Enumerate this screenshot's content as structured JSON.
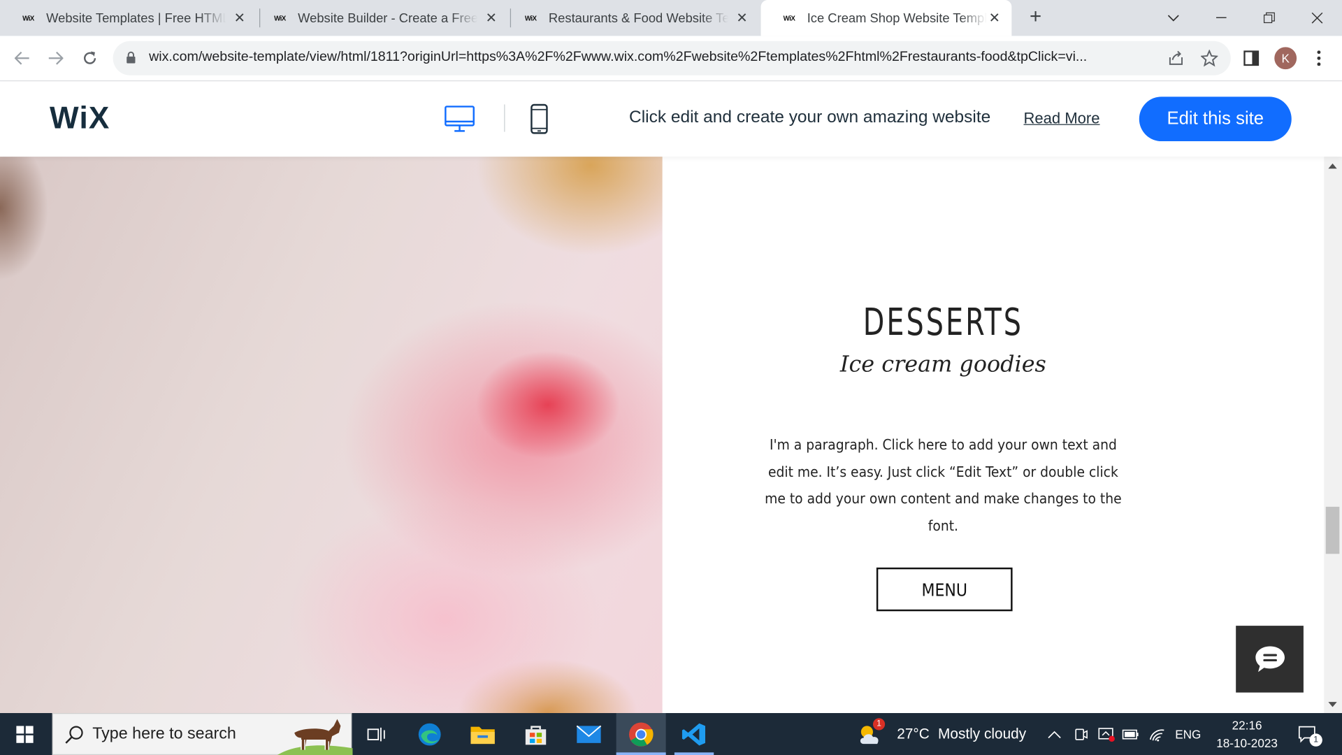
{
  "browser": {
    "tabs": [
      {
        "favicon": "WiX",
        "title": "Website Templates | Free HTML5",
        "active": false
      },
      {
        "favicon": "WiX",
        "title": "Website Builder - Create a Free W",
        "active": false
      },
      {
        "favicon": "WiX",
        "title": "Restaurants & Food Website Tem",
        "active": false
      },
      {
        "favicon": "WiX",
        "title": "Ice Cream Shop Website Templa",
        "active": true
      }
    ],
    "url": "wix.com/website-template/view/html/1811?originUrl=https%3A%2F%2Fwww.wix.com%2Fwebsite%2Ftemplates%2Fhtml%2Frestaurants-food&tpClick=vi...",
    "profile_initial": "K"
  },
  "wix_bar": {
    "logo": "WiX",
    "promo_text": "Click edit and create your own amazing website",
    "read_more": "Read More",
    "edit_button": "Edit this site",
    "accent_color": "#116dff"
  },
  "content": {
    "heading": "DESSERTS",
    "subheading": "Ice cream goodies",
    "paragraph": "I'm a paragraph. Click here to add your own text and edit me. It’s easy. Just click “Edit Text” or double click me to add your own content and make changes to the font.",
    "menu_button": "MENU"
  },
  "taskbar": {
    "search_placeholder": "Type here to search",
    "weather_temp": "27°C",
    "weather_desc": "Mostly cloudy",
    "weather_badge": "1",
    "language": "ENG",
    "time": "22:16",
    "date": "18-10-2023",
    "notification_count": "1"
  }
}
